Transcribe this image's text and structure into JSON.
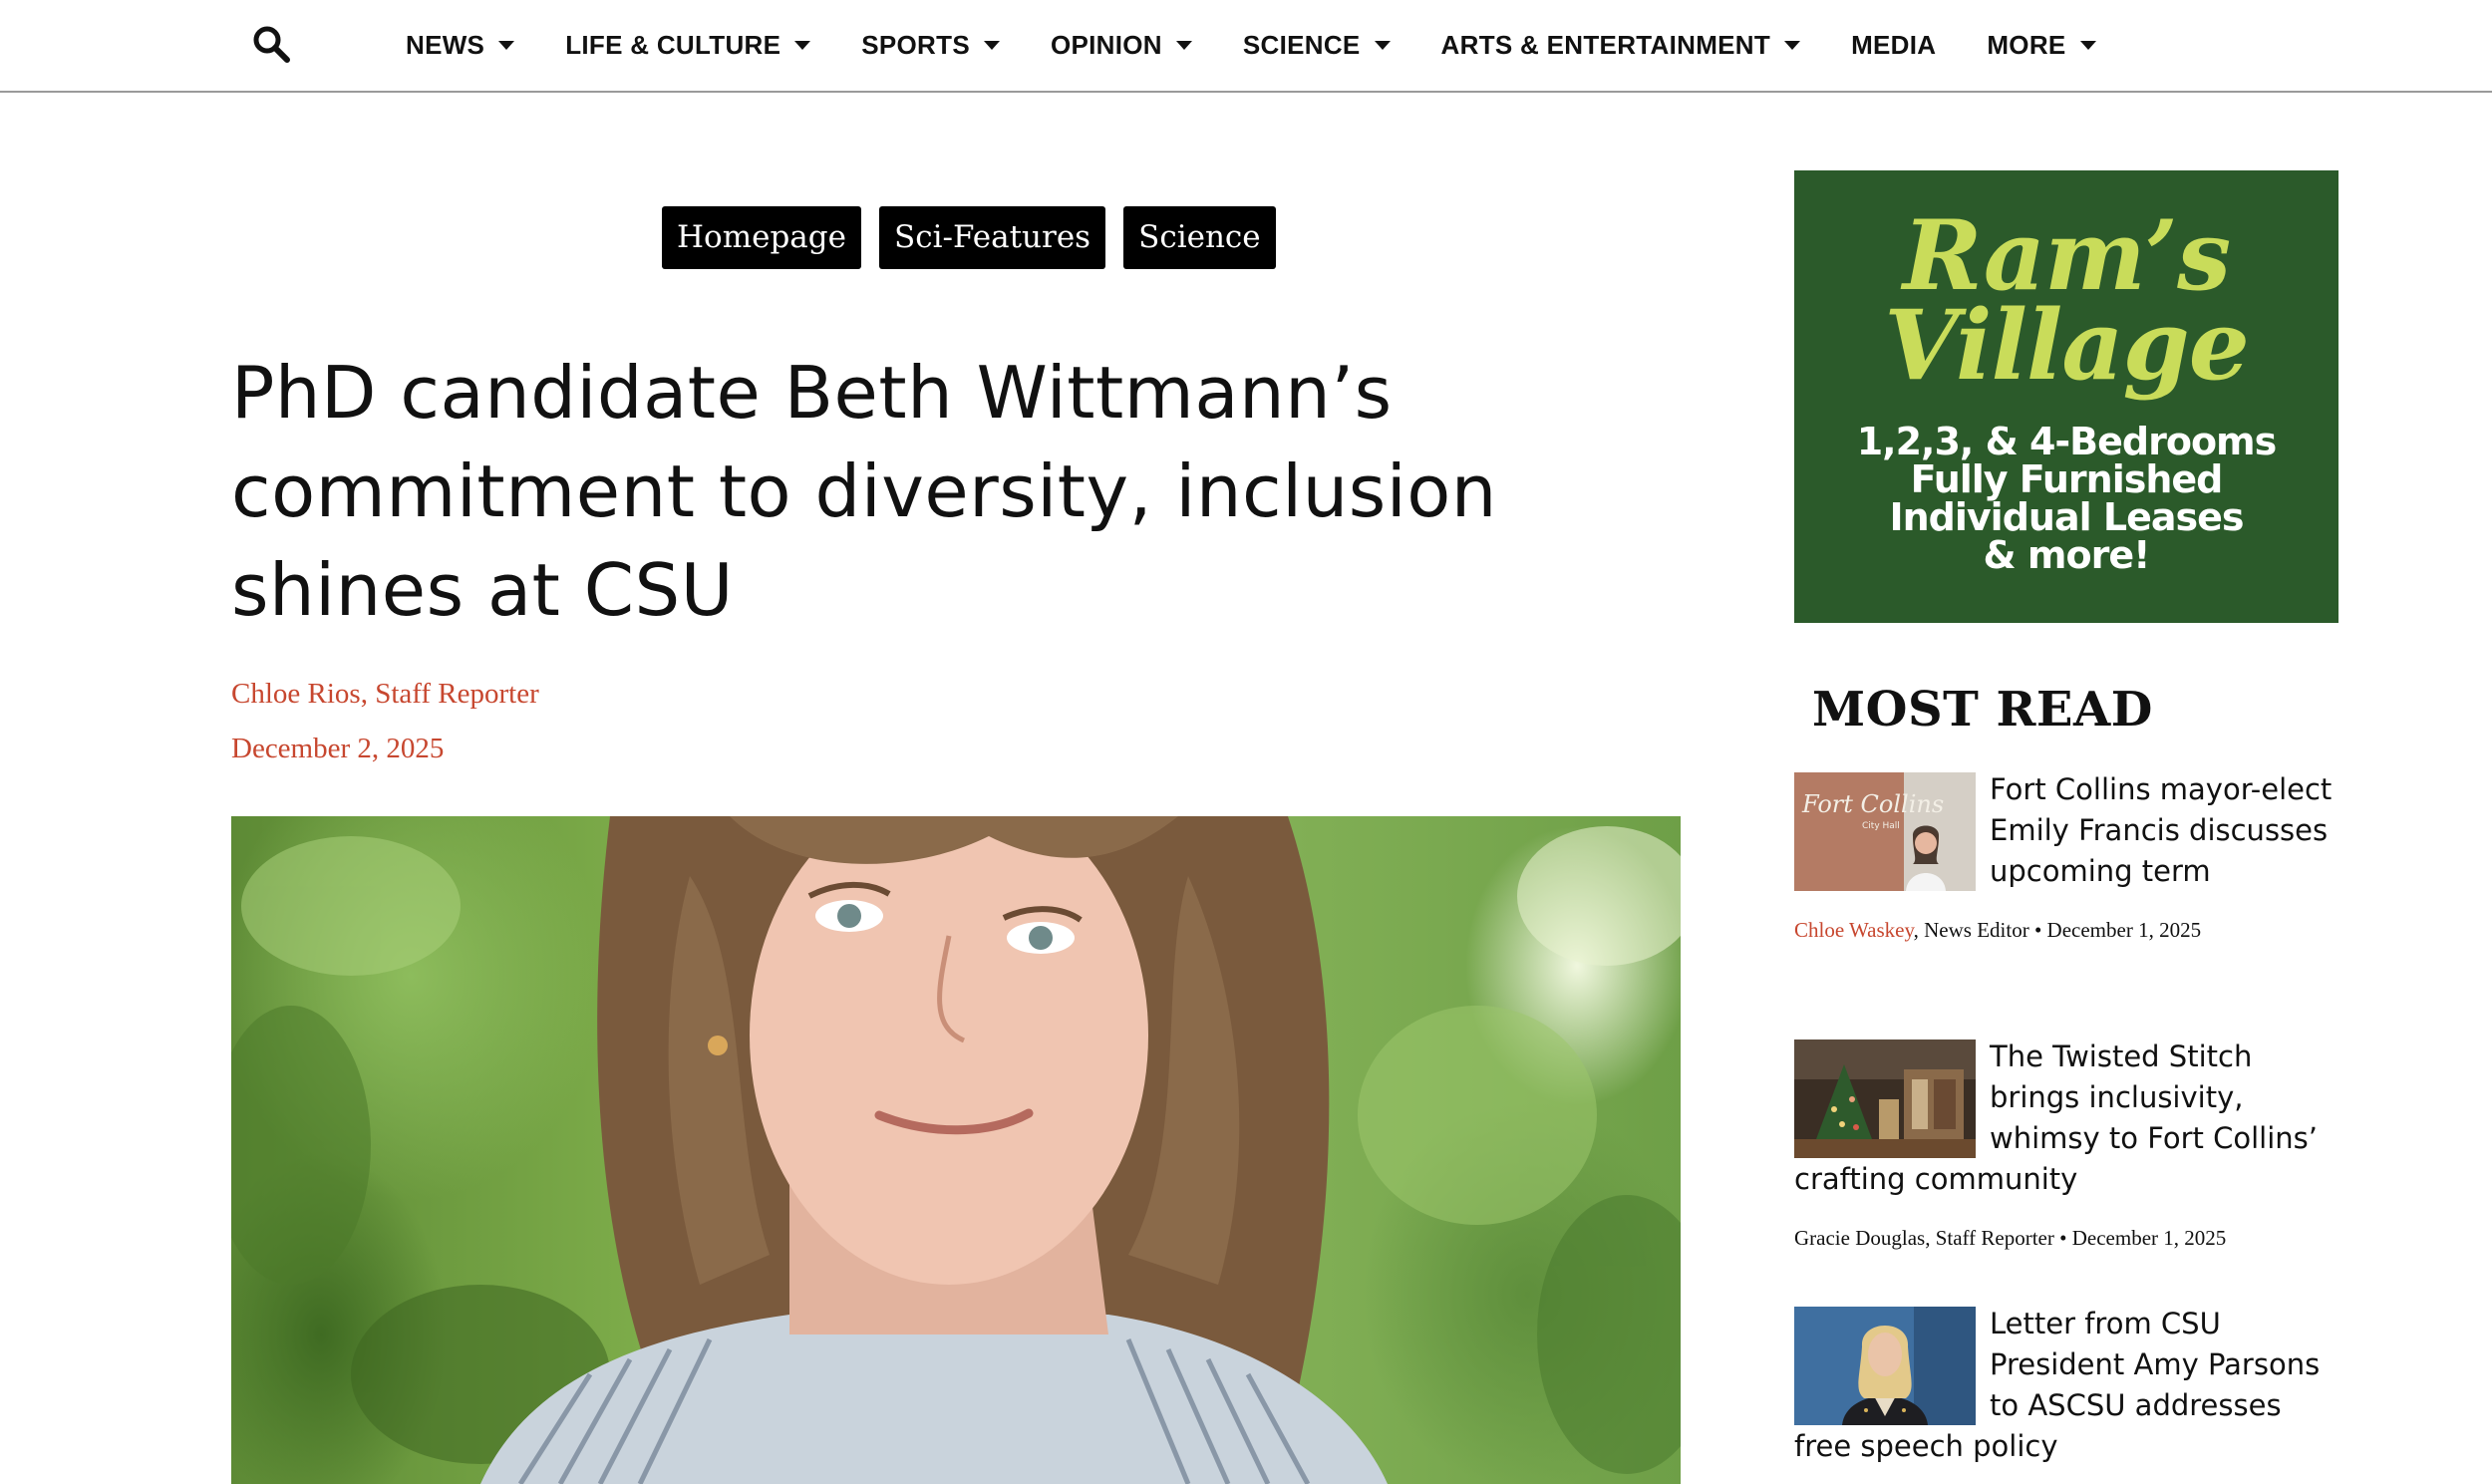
{
  "nav": {
    "items": [
      {
        "label": "NEWS",
        "dropdown": true
      },
      {
        "label": "LIFE & CULTURE",
        "dropdown": true
      },
      {
        "label": "SPORTS",
        "dropdown": true
      },
      {
        "label": "OPINION",
        "dropdown": true
      },
      {
        "label": "SCIENCE",
        "dropdown": true
      },
      {
        "label": "ARTS & ENTERTAINMENT",
        "dropdown": true
      },
      {
        "label": "MEDIA",
        "dropdown": false
      },
      {
        "label": "MORE",
        "dropdown": true
      }
    ],
    "search_icon": "search-icon"
  },
  "article": {
    "tags": [
      "Homepage",
      "Sci-Features",
      "Science"
    ],
    "headline_lines": [
      "PhD candidate Beth Wittmann’s",
      "commitment to diversity, inclusion",
      "shines at CSU"
    ],
    "byline": "Chloe Rios, Staff Reporter",
    "date": "December 2, 2025"
  },
  "ad": {
    "brand_line1": "Ram’s",
    "brand_line2": "Village",
    "lines": [
      "1,2,3, & 4-Bedrooms",
      "Fully Furnished",
      "Individual Leases",
      "& more!"
    ],
    "colors": {
      "background": "#2b5a2a",
      "brand": "#c9dc5a"
    }
  },
  "most_read": {
    "title": "MOST READ",
    "stories": [
      {
        "title": "Fort Collins mayor-elect Emily Francis discusses upcoming term",
        "author": "Chloe Waskey",
        "role": ", News Editor",
        "date": " • December 1, 2025",
        "thumb_sign": "Fort Collins",
        "thumb_sub": "City Hall"
      },
      {
        "title": "The Twisted Stitch brings inclusivity, whimsy to Fort Collins’ crafting community",
        "author": "Gracie Douglas",
        "role": ", Staff Reporter",
        "date": " • December 1, 2025"
      },
      {
        "title": "Letter from CSU President Amy Parsons to ASCSU addresses free speech policy"
      }
    ]
  },
  "colors": {
    "accent": "#c7472f",
    "tag_bg": "#000000"
  }
}
